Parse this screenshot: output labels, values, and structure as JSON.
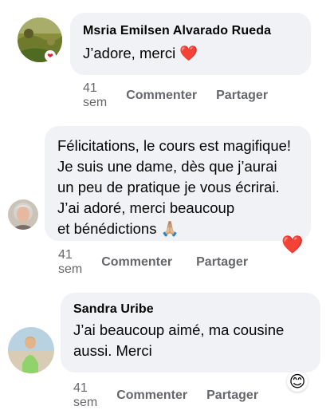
{
  "comments": [
    {
      "author": "Msria Emilsen Alvarado Rueda",
      "text": "J’adore, merci ❤️",
      "time": "41 sem",
      "comment_label": "Commenter",
      "share_label": "Partager",
      "avatar_badge": "❤",
      "reaction": ""
    },
    {
      "author": "",
      "text": "Félicitations, le cours est magifique!\nJe suis une dame, dès que j’aurai\nun peu de pratique je vous écrirai.\nJ’ai adoré, merci beaucoup\net bénédictions 🙏🏼",
      "time": "41 sem",
      "comment_label": "Commenter",
      "share_label": "Partager",
      "reaction": "❤️"
    },
    {
      "author": "Sandra Uribe",
      "text": "J’ai beaucoup aimé, ma cousine\naussi. Merci",
      "time": "41 sem",
      "comment_label": "Commenter",
      "share_label": "Partager",
      "reaction": "😊"
    }
  ],
  "colors": {
    "bubble": "#f0f2f5",
    "meta": "#65676b",
    "text": "#050505",
    "heart": "#e41e3f"
  }
}
